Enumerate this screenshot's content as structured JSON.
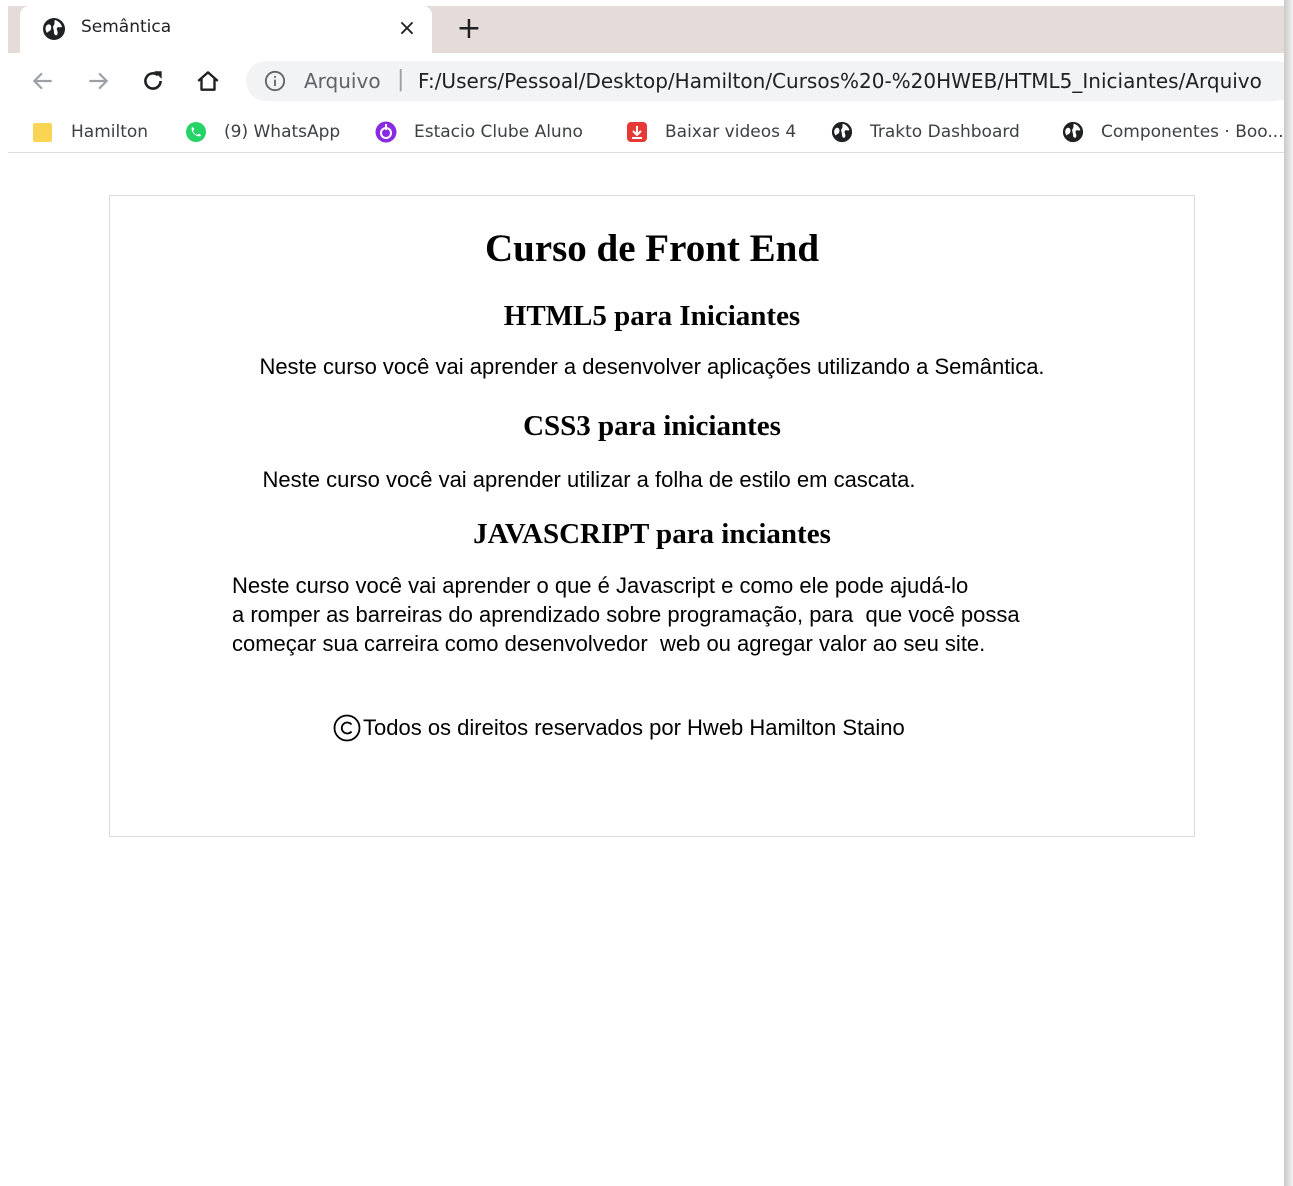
{
  "browser": {
    "tab": {
      "title": "Semântica",
      "close": "×"
    },
    "new_tab": "+",
    "omnibox": {
      "origin_label": "Arquivo",
      "separator": "|",
      "url": "F:/Users/Pessoal/Desktop/Hamilton/Cursos%20-%20HWEB/HTML5_Iniciantes/Arquivo"
    },
    "bookmarks": [
      {
        "label": "Hamilton",
        "icon": "folder-icon",
        "color": "#f9d553"
      },
      {
        "label": "(9) WhatsApp",
        "icon": "whatsapp-icon",
        "color": "#25d366"
      },
      {
        "label": "Estacio Clube Aluno",
        "icon": "estacio-icon",
        "color": "#8a2be2"
      },
      {
        "label": "Baixar videos 4",
        "icon": "download-icon",
        "color": "#e53935"
      },
      {
        "label": "Trakto Dashboard",
        "icon": "globe-icon",
        "color": "#202124"
      },
      {
        "label": "Componentes · Boo...",
        "icon": "globe-icon",
        "color": "#202124"
      }
    ]
  },
  "page": {
    "title": "Curso de Front End",
    "sections": [
      {
        "heading": "HTML5 para Iniciantes",
        "text": "Neste curso você vai aprender a desenvolver aplicações utilizando a Semântica."
      },
      {
        "heading": "CSS3 para iniciantes",
        "text": "Neste curso você vai aprender utilizar a folha de estilo em cascata."
      },
      {
        "heading": "JAVASCRIPT para inciantes",
        "lines": [
          "Neste curso você vai aprender o que é Javascript e como ele pode ajudá-lo",
          "a romper as barreiras do aprendizado sobre programação, para  que você possa",
          "começar sua carreira como desenvolvedor  web ou agregar valor ao seu site."
        ]
      }
    ],
    "footer": "Todos os direitos reservados por Hweb Hamilton Staino"
  }
}
